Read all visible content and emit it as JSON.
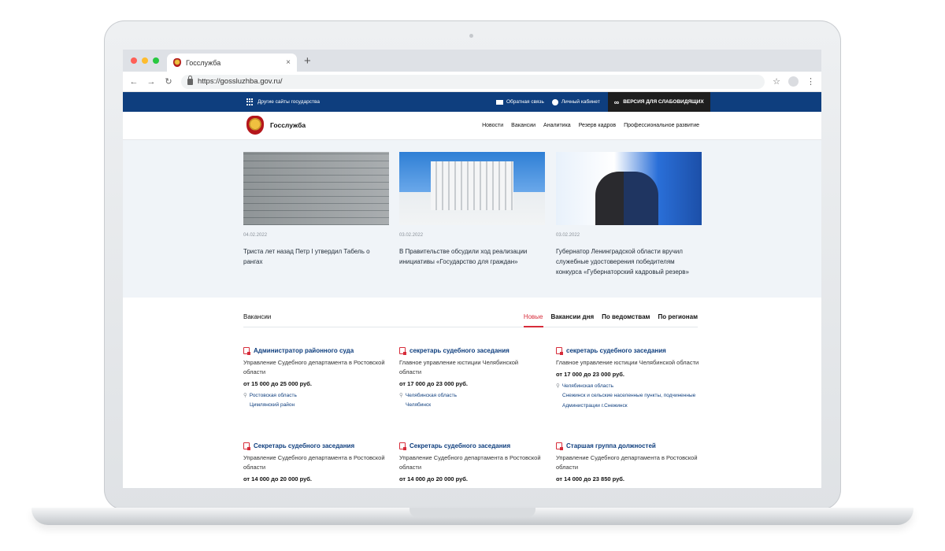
{
  "browser": {
    "tab_title": "Госслужба",
    "tab_close": "×",
    "new_tab": "+",
    "back": "←",
    "forward": "→",
    "reload": "↻",
    "url": "https://gossluzhba.gov.ru/",
    "bookmark": "☆",
    "menu": "⋮",
    "traffic_colors": [
      "#ff5f57",
      "#febc2e",
      "#28c840"
    ]
  },
  "topbar": {
    "other_sites": "Другие сайты государства",
    "feedback": "Обратная связь",
    "account": "Личный кабинет",
    "accessible_version": "ВЕРСИЯ ДЛЯ СЛАБОВИДЯЩИХ",
    "accessible_icon": "∞"
  },
  "header": {
    "site_title": "Госслужба",
    "nav": [
      "Новости",
      "Вакансии",
      "Аналитика",
      "Резерв кадров",
      "Профессиональное развитие"
    ]
  },
  "news": [
    {
      "date": "04.02.2022",
      "title": "Триста лет назад Петр I утвердил Табель о рангах"
    },
    {
      "date": "03.02.2022",
      "title": "В Правительстве обсудили ход реализации инициативы «Государство для граждан»"
    },
    {
      "date": "03.02.2022",
      "title": "Губернатор Ленинградской области вручил служебные удостоверения победителям конкурса «Губернаторский кадровый резерв»"
    }
  ],
  "vacancies": {
    "title": "Вакансии",
    "tabs": [
      "Новые",
      "Вакансии дня",
      "По ведомствам",
      "По регионам"
    ],
    "items": [
      {
        "name": "Администратор районного суда",
        "org": "Управление Судебного департамента в Ростовской области",
        "salary": "от 15 000 до 25 000 руб.",
        "region": "Ростовская область",
        "place": "Цимлянский район"
      },
      {
        "name": "секретарь судебного заседания",
        "org": "Главное управление юстиции Челябинской области",
        "salary": "от 17 000 до 23 000 руб.",
        "region": "Челябинская область",
        "place": "Челябинск"
      },
      {
        "name": "секретарь судебного заседания",
        "org": "Главное управление юстиции Челябинской области",
        "salary": "от 17 000 до 23 000 руб.",
        "region": "Челябинская область",
        "place": "Снежинск и сельские населенные пункты, подчиненные Администрации г.Снежинск"
      },
      {
        "name": "Секретарь судебного заседания",
        "org": "Управление Судебного департамента в Ростовской области",
        "salary": "от 14 000 до 20 000 руб."
      },
      {
        "name": "Секретарь судебного заседания",
        "org": "Управление Судебного департамента в Ростовской области",
        "salary": "от 14 000 до 20 000 руб."
      },
      {
        "name": "Старшая группа должностей",
        "org": "Управление Судебного департамента в Ростовской области",
        "salary": "от 14 000 до 23 850 руб."
      }
    ]
  }
}
